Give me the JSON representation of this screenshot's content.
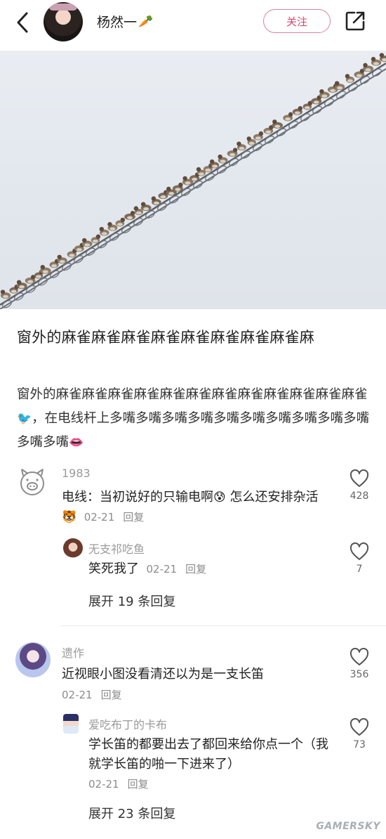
{
  "header": {
    "username": "杨然一",
    "username_emoji": "🥕",
    "follow_label": "关注",
    "icons": {
      "back": "chevron-left-icon",
      "share": "share-icon"
    }
  },
  "colors": {
    "accent": "#d8476d",
    "text": "#222222",
    "muted": "#8c8c8c"
  },
  "post": {
    "title": "窗外的麻雀麻雀麻雀麻雀麻雀麻雀麻雀麻雀麻",
    "body_part1": "窗外的麻雀麻雀麻雀麻雀麻雀麻雀麻雀麻雀麻雀麻雀麻雀麻雀",
    "body_bird_emoji": "🐦",
    "body_part2": "，在电线杆上多嘴多嘴多嘴多嘴多嘴多嘴多嘴多嘴多嘴多嘴多嘴多嘴",
    "body_lips_emoji": "👄"
  },
  "comments": [
    {
      "name": "1983",
      "text_before": "电线：当初说好的只输电啊",
      "emoji1": "😰",
      "text_middle": "怎么还安排杂活",
      "emoji2": "🐯",
      "date": "02-21",
      "reply_label": "回复",
      "likes": "428",
      "replies": [
        {
          "name": "无支祁吃鱼",
          "text": "笑死我了",
          "date": "02-21",
          "reply_label": "回复",
          "likes": "7"
        }
      ],
      "expand_label": "展开 19 条回复"
    },
    {
      "name": "遗作",
      "text": "近视眼小图没看清还以为是一支长笛",
      "date": "02-21",
      "reply_label": "回复",
      "likes": "356",
      "replies": [
        {
          "name": "爱吃布丁的卡布",
          "text": "学长笛的都要出去了都回来给你点一个（我就学长笛的啪一下进来了）",
          "date": "02-21",
          "reply_label": "回复",
          "likes": "73"
        }
      ],
      "expand_label": "展开 23 条回复"
    }
  ],
  "watermark": "GAMERSKY"
}
